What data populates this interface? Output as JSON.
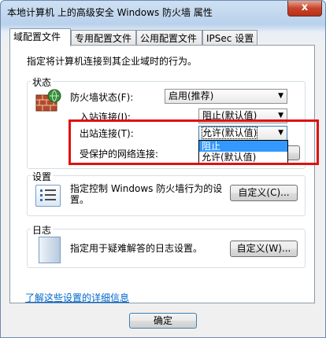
{
  "window": {
    "title": "本地计算机 上的高级安全 Windows 防火墙 属性",
    "close_glyph": "x"
  },
  "tabs": [
    {
      "label": "域配置文件"
    },
    {
      "label": "专用配置文件"
    },
    {
      "label": "公用配置文件"
    },
    {
      "label": "IPSec 设置"
    }
  ],
  "panel": {
    "description": "指定将计算机连接到其企业域时的行为。",
    "state": {
      "title": "状态",
      "firewall_state_label": "防火墙状态(F):",
      "firewall_state_value": "启用(推荐)",
      "inbound_label": "入站连接(I):",
      "inbound_value": "阻止(默认值)",
      "outbound_label": "出站连接(T):",
      "outbound_value": "允许(默认值)",
      "protected_label": "受保护的网络连接:",
      "dropdown_options": [
        "阻止",
        "允许(默认值)"
      ]
    },
    "settings": {
      "title": "设置",
      "description": "指定控制 Windows 防火墙行为的设置。",
      "button": "自定义(C)..."
    },
    "logging": {
      "title": "日志",
      "description": "指定用于疑难解答的日志设置。",
      "button": "自定义(W)..."
    },
    "learn_more_link": "了解这些设置的详细信息"
  },
  "footer": {
    "ok_button": "确定"
  },
  "colors": {
    "highlight": "#3399ff",
    "callout": "#e01010",
    "link": "#0066cc"
  }
}
